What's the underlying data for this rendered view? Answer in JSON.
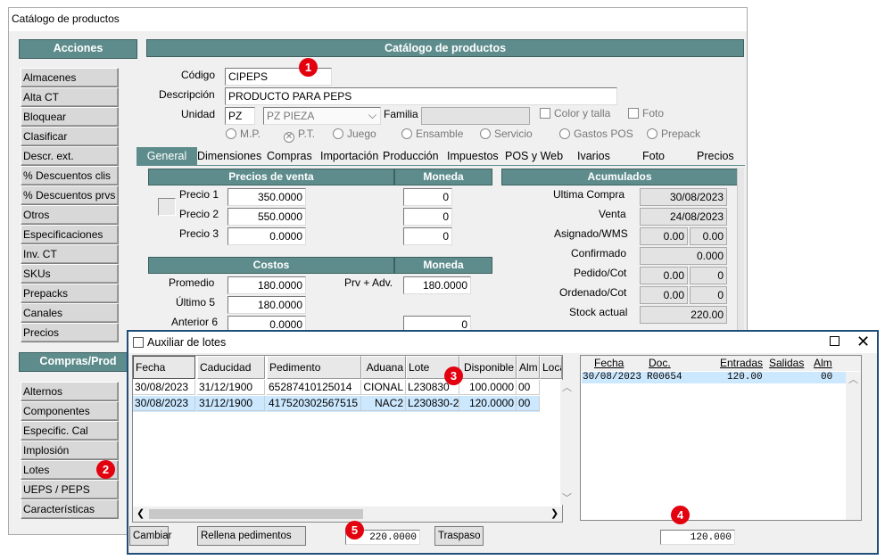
{
  "window": {
    "title": "Catálogo de productos"
  },
  "sidebar": {
    "acciones_header": "Acciones",
    "acciones": [
      "Almacenes",
      "Alta CT",
      "Bloquear",
      "Clasificar",
      "Descr. ext.",
      "% Descuentos clis",
      "% Descuentos prvs",
      "Otros",
      "Especificaciones",
      "Inv. CT",
      "SKUs",
      "Prepacks",
      "Canales",
      "Precios"
    ],
    "compras_header": "Compras/Prod",
    "compras": [
      "Alternos",
      "Componentes",
      "Especific. Cal",
      "Implosión",
      "Lotes",
      "UEPS / PEPS",
      "Características"
    ]
  },
  "main": {
    "header": "Catálogo de productos",
    "codigo_label": "Código",
    "codigo": "CIPEPS",
    "descripcion_label": "Descripción",
    "descripcion": "PRODUCTO PARA PEPS",
    "unidad_label": "Unidad",
    "unidad": "PZ",
    "unidad_desc": "PZ  PIEZA",
    "familia_label": "Familia",
    "color_talla": "Color y talla",
    "foto": "Foto",
    "radios": [
      "M.P.",
      "P.T.",
      "Juego",
      "Ensamble",
      "Servicio",
      "Gastos POS",
      "Prepack"
    ],
    "selected_radio": "P.T."
  },
  "tabs": [
    "General",
    "Dimensiones",
    "Compras",
    "Importación",
    "Producción",
    "Impuestos",
    "POS y Web",
    "Ivarios",
    "Foto",
    "Precios"
  ],
  "precios": {
    "header": "Precios de venta",
    "moneda_header": "Moneda",
    "rows": [
      {
        "label": "Precio 1",
        "value": "350.0000",
        "moneda": "0"
      },
      {
        "label": "Precio 2",
        "value": "550.0000",
        "moneda": "0"
      },
      {
        "label": "Precio 3",
        "value": "0.0000",
        "moneda": "0"
      }
    ]
  },
  "costos": {
    "header": "Costos",
    "moneda_header": "Moneda",
    "rows": [
      {
        "label": "Promedio",
        "value": "180.0000"
      },
      {
        "label": "Último 5",
        "value": "180.0000"
      },
      {
        "label": "Anterior 6",
        "value": "0.0000"
      }
    ],
    "prv_label": "Prv + Adv.",
    "prv_value": "180.0000",
    "moneda": "0"
  },
  "acumulados": {
    "header": "Acumulados",
    "ultima_compra_label": "Ultima  Compra",
    "ultima_compra": "30/08/2023",
    "venta_label": "Venta",
    "venta": "24/08/2023",
    "asignado_label": "Asignado/WMS",
    "asignado_a": "0.00",
    "asignado_b": "0.00",
    "confirmado_label": "Confirmado",
    "confirmado": "0.000",
    "pedido_label": "Pedido/Cot",
    "pedido_a": "0.00",
    "pedido_b": "0",
    "ordenado_label": "Ordenado/Cot",
    "ordenado_a": "0.00",
    "ordenado_b": "0",
    "stock_label": "Stock actual",
    "stock": "220.00"
  },
  "lotes": {
    "title": "Auxiliar de lotes",
    "columns": [
      "Fecha",
      "Caducidad",
      "Pedimento",
      "Aduana",
      "Lote",
      "Disponible",
      "Alm",
      "Localiza"
    ],
    "rows": [
      [
        "30/08/2023",
        "31/12/1900",
        "65287410125014",
        "CIONAL",
        "L230830",
        "100.0000",
        "00"
      ],
      [
        "30/08/2023",
        "31/12/1900",
        "417520302567515",
        "NAC2",
        "L230830-2",
        "120.0000",
        "00"
      ]
    ],
    "right_columns": [
      "Fecha",
      "Doc.",
      "Entradas",
      "Salidas",
      "Alm"
    ],
    "right_rows": [
      [
        "30/08/2023",
        "R00654",
        "120.00",
        "",
        "00"
      ]
    ],
    "buttons": {
      "cambiar": "Cambiar",
      "rellena": "Rellena pedimentos",
      "traspaso": "Traspaso"
    },
    "total_left": "220.0000",
    "total_right": "120.000"
  },
  "badges": [
    "1",
    "2",
    "3",
    "4",
    "5"
  ],
  "colors": {
    "header_bg": "#5e8c8c",
    "badge": "#e3000f",
    "selected_row": "#cce8ff",
    "window_border": "#1f4e79"
  }
}
